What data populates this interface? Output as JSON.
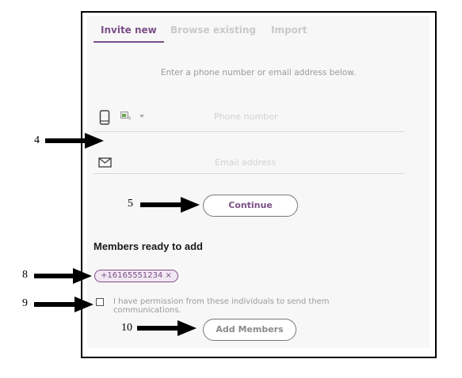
{
  "tabs": [
    {
      "label": "Invite new",
      "active": true
    },
    {
      "label": "Browse existing",
      "active": false
    },
    {
      "label": "Import",
      "active": false
    }
  ],
  "instruction": "Enter a phone number or email address below.",
  "phone": {
    "placeholder": "Phone number",
    "icon": "phone-icon",
    "country_icon": "flag-icon"
  },
  "email": {
    "placeholder": "Email address",
    "icon": "envelope-icon"
  },
  "continue_label": "Continue",
  "members": {
    "title": "Members ready to add",
    "chips": [
      "+16165551234 ×"
    ]
  },
  "permission_text": "I have permission from these individuals to send them communications.",
  "add_members_label": "Add Members",
  "annotations": [
    "4",
    "5",
    "8",
    "9",
    "10"
  ],
  "colors": {
    "accent": "#7a4f87",
    "chip_bg": "#f1e7f3"
  }
}
